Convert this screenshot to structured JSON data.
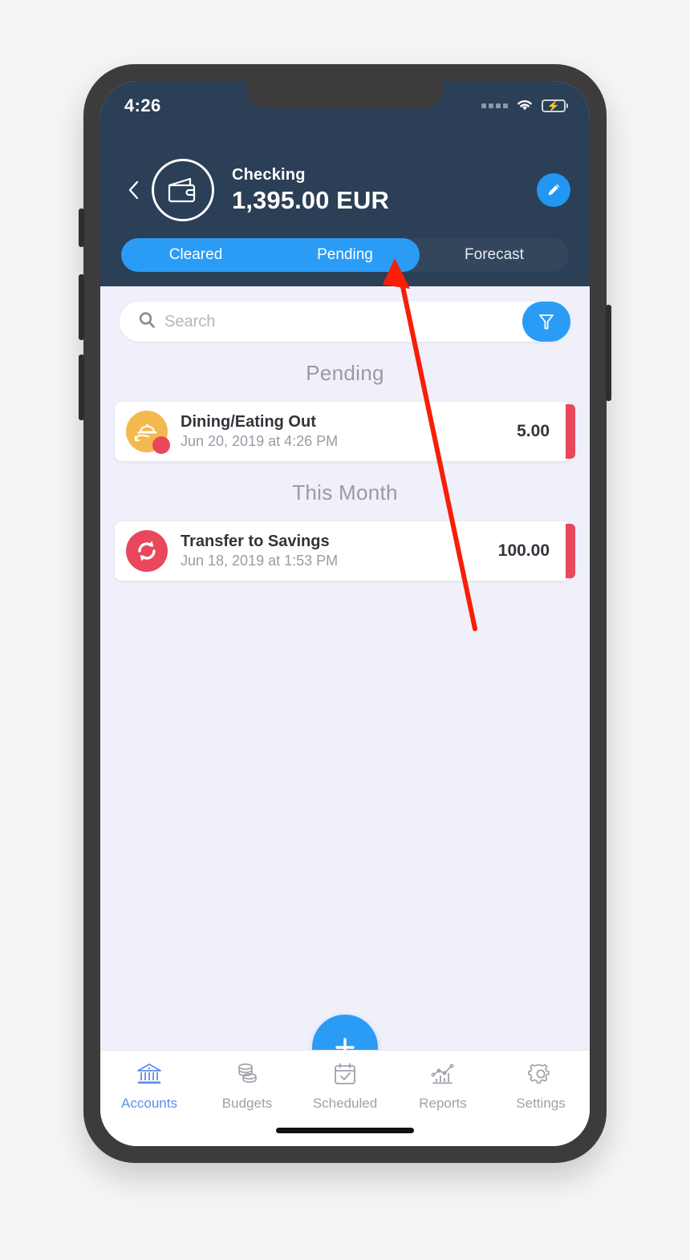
{
  "colors": {
    "header_bg": "#2b3f56",
    "accent_blue": "#2b9cf6",
    "content_bg": "#f0f0fa",
    "flag_red": "#e8475c",
    "dining_orange": "#f4b94e",
    "transfer_red": "#e8475c",
    "tab_active": "#5b8def",
    "annotation_red": "#f81e08"
  },
  "status_bar": {
    "time": "4:26",
    "signal_icon": "signal-dots-icon",
    "wifi_icon": "wifi-icon",
    "battery_icon": "battery-charging-icon"
  },
  "header": {
    "back_icon": "chevron-left-icon",
    "account_icon": "wallet-icon",
    "account_name": "Checking",
    "account_balance": "1,395.00 EUR",
    "edit_icon": "pencil-icon"
  },
  "segments": {
    "items": [
      {
        "label": "Cleared",
        "active": true
      },
      {
        "label": "Pending",
        "active": true
      },
      {
        "label": "Forecast",
        "active": false
      }
    ]
  },
  "search": {
    "placeholder": "Search",
    "value": "",
    "search_icon": "search-icon",
    "filter_icon": "filter-icon"
  },
  "sections": [
    {
      "header": "Pending",
      "transactions": [
        {
          "icon": "dining-icon",
          "icon_bg": "#f4b94e",
          "badge": true,
          "title": "Dining/Eating Out",
          "date": "Jun 20, 2019 at 4:26 PM",
          "amount": "5.00",
          "flag_color": "#e8475c"
        }
      ]
    },
    {
      "header": "This Month",
      "transactions": [
        {
          "icon": "transfer-icon",
          "icon_bg": "#e8475c",
          "badge": false,
          "title": "Transfer to Savings",
          "date": "Jun 18, 2019 at 1:53 PM",
          "amount": "100.00",
          "flag_color": "#e8475c"
        }
      ]
    }
  ],
  "fab": {
    "icon": "plus-icon",
    "label": "+"
  },
  "tabbar": {
    "items": [
      {
        "label": "Accounts",
        "icon": "bank-icon",
        "active": true
      },
      {
        "label": "Budgets",
        "icon": "coins-icon",
        "active": false
      },
      {
        "label": "Scheduled",
        "icon": "calendar-check-icon",
        "active": false
      },
      {
        "label": "Reports",
        "icon": "chart-icon",
        "active": false
      },
      {
        "label": "Settings",
        "icon": "gear-icon",
        "active": false
      }
    ]
  }
}
